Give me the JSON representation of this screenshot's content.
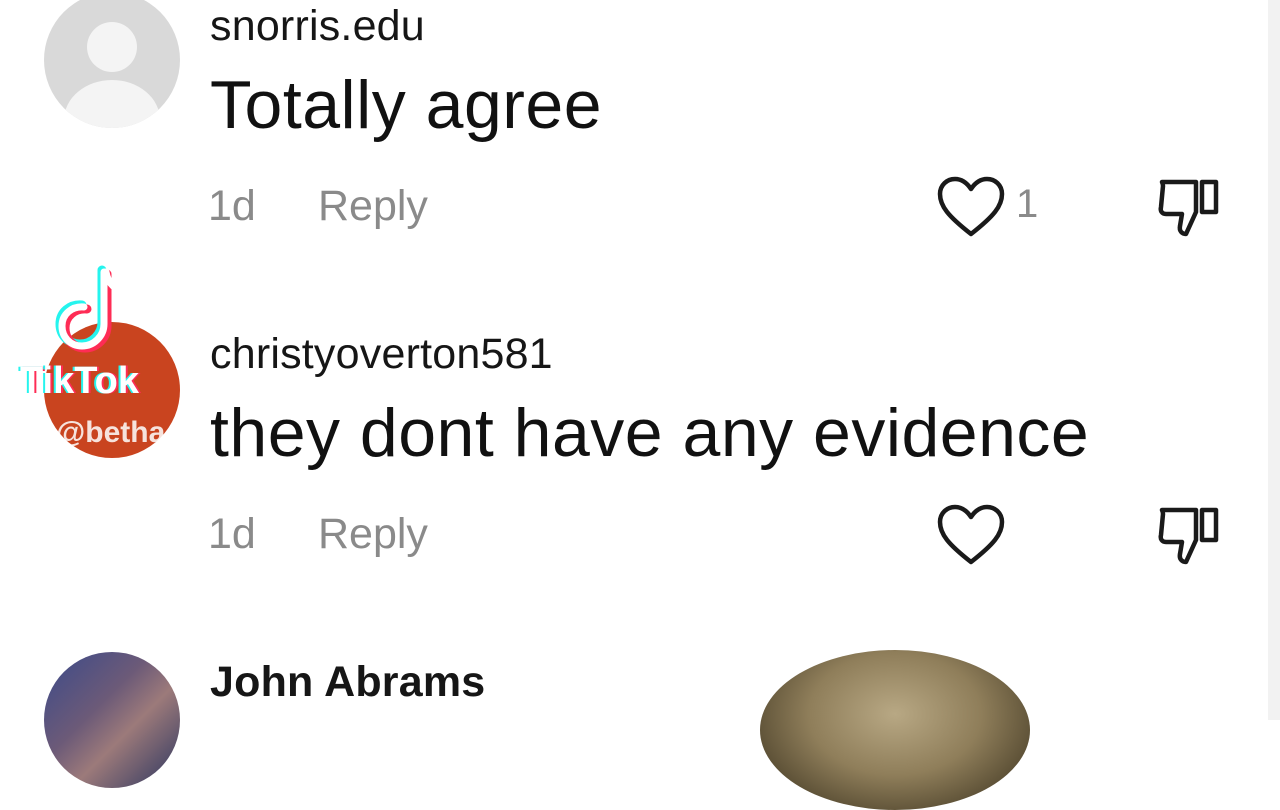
{
  "comments": [
    {
      "username": "snorris.edu",
      "text": "Totally agree",
      "time": "1d",
      "reply_label": "Reply",
      "like_count": "1"
    },
    {
      "username": "christyoverton581",
      "text": "they dont have any evidence",
      "time": "1d",
      "reply_label": "Reply",
      "like_count": ""
    },
    {
      "username": "John Abrams"
    }
  ],
  "watermark": {
    "brand": "TikTok",
    "handle": "@betha"
  },
  "icons": {
    "like": "heart-outline-icon",
    "dislike": "thumbs-down-icon",
    "default_avatar": "user-silhouette-icon"
  },
  "colors": {
    "meta_text": "#8a8a8a",
    "avatar_default": "#d9d9d9",
    "avatar_red": "#c9441f"
  }
}
